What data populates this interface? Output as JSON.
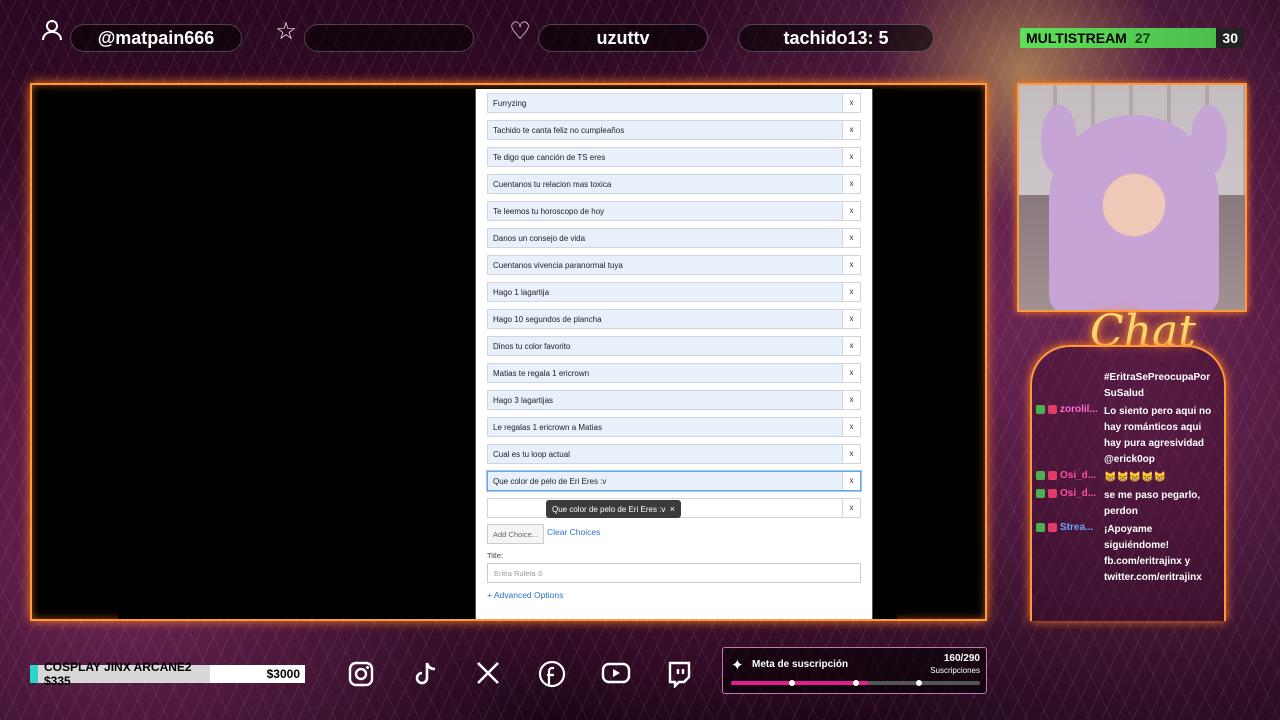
{
  "topbar": {
    "recent_follower": "@matpain666",
    "recent_sub": "",
    "recent_heart": "uzuttv",
    "top_tip": "tachido13: 5",
    "multistream_label": "MULTISTREAM",
    "multistream_count": "27",
    "multistream_goal": "30"
  },
  "form": {
    "choices": [
      "Furryzing",
      "Tachido te canta feliz no cumpleaños",
      "Te digo que canción de TS eres",
      "Cuentanos tu relacion mas toxica",
      "Te leemos tu horoscopo de hoy",
      "Danos un consejo de vida",
      "Cuentanos vivencia paranormal tuya",
      "Hago 1 lagartija",
      "Hago 10 segundos de plancha",
      "Dinos tu color favorito",
      "Matias te regala 1 ericrown",
      "Hago 3 lagartijas",
      "Le regalas 1 ericrown a Matias",
      "Cual es tu loop actual",
      "Que color de pelo de Eri Eres :v",
      ""
    ],
    "remove_label": "x",
    "tooltip_text": "Que color de pelo de Eri Eres :v",
    "tooltip_close": "×",
    "add_choice_label": "Add Choice...",
    "clear_choices_label": "Clear Choices",
    "title_label": "Title:",
    "title_placeholder": "Eritra Ruleta 3",
    "advanced_label": "+ Advanced Options"
  },
  "chat": {
    "heading": "Chat",
    "messages": [
      {
        "user": "",
        "text": "#EritraSePreocupaPor SuSalud",
        "color": "#ff6ad5"
      },
      {
        "user": "zorolil...",
        "text": "Lo siento pero aqui no hay románticos aqui hay pura agresividad @erick0op",
        "color": "#ff6ad5"
      },
      {
        "user": "Osi_d...",
        "text": "😸😸😸😸😸",
        "color": "#ff4fa3"
      },
      {
        "user": "Osi_d...",
        "text": "se me paso pegarlo, perdon",
        "color": "#ff4fa3"
      },
      {
        "user": "Strea...",
        "text": "¡Apoyame siguiéndome! fb.com/eritrajinx y twitter.com/eritrajinx",
        "color": "#6aa7ff"
      }
    ]
  },
  "sub_goal": {
    "label": "Meta de suscripción",
    "count": "160/290",
    "subtitle": "Suscripciones",
    "progress": 0.55
  },
  "donation": {
    "label": "COSPLAY JINX ARCANE2 $335",
    "goal": "$3000"
  },
  "socials": [
    "instagram-icon",
    "tiktok-icon",
    "x-icon",
    "facebook-icon",
    "youtube-icon",
    "twitch-icon"
  ],
  "colors": {
    "frame": "#ff9a3a",
    "accent_pink": "#e01e91",
    "multistream_green": "#5ee05a"
  }
}
